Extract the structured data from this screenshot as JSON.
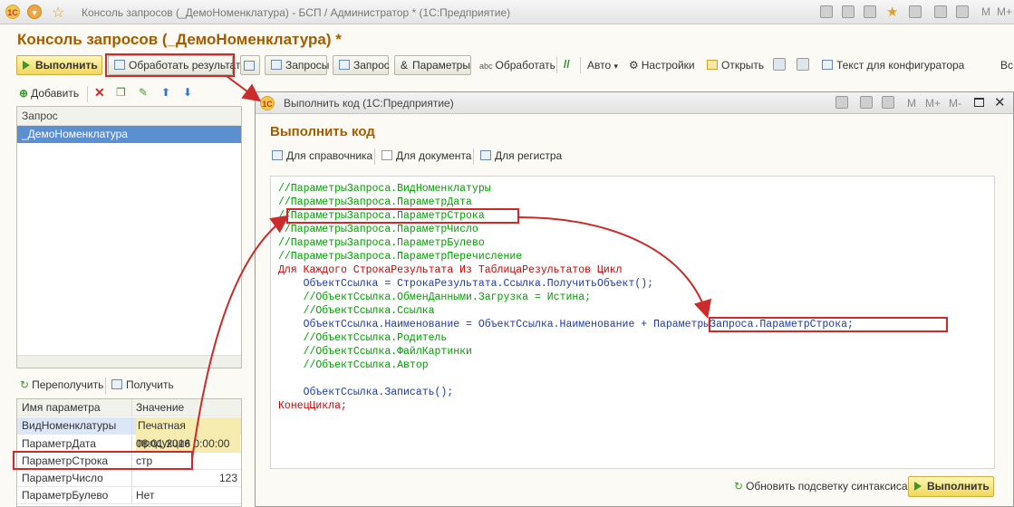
{
  "window": {
    "title": "Консоль запросов (_ДемоНоменклатура) - БСП / Администратор * (1С:Предприятие)",
    "m_labels": [
      "M",
      "M+",
      "M-"
    ]
  },
  "page": {
    "title": "Консоль запросов (_ДемоНоменклатура) *"
  },
  "toolbar": {
    "run": "Выполнить",
    "process": "Обработать результат",
    "queries": "Запросы",
    "query": "Запрос",
    "params": "Параметры",
    "process2": "Обработать",
    "auto": "Авто",
    "settings": "Настройки",
    "open": "Открыть",
    "config_text": "Текст для конфигуратора",
    "more": "Вс"
  },
  "left": {
    "add": "Добавить",
    "list_header": "Запрос",
    "list_item": "_ДемоНоменклатура",
    "refetch": "Переполучить",
    "get": "Получить",
    "param_headers": [
      "Имя параметра",
      "Значение"
    ],
    "params": [
      [
        "ВидНоменклатуры",
        "Печатная продукция"
      ],
      [
        "ПараметрДата",
        "08.01.2016 0:00:00"
      ],
      [
        "ПараметрСтрока",
        "стр"
      ],
      [
        "ПараметрЧисло",
        "123"
      ],
      [
        "ПараметрБулево",
        "Нет"
      ]
    ]
  },
  "dialog": {
    "bar_title": "Выполнить код (1С:Предприятие)",
    "title": "Выполнить код",
    "btn_catalog": "Для справочника",
    "btn_document": "Для документа",
    "btn_register": "Для регистра",
    "code": [
      "//ПараметрыЗапроса.ВидНоменклатуры",
      "//ПараметрыЗапроса.ПараметрДата",
      "//ПараметрыЗапроса.ПараметрСтрока",
      "//ПараметрыЗапроса.ПараметрЧисло",
      "//ПараметрыЗапроса.ПараметрБулево",
      "//ПараметрыЗапроса.ПараметрПеречисление",
      "Для Каждого СтрокаРезультата Из ТаблицаРезультатов Цикл",
      "    ОбъектСсылка = СтрокаРезультата.Ссылка.ПолучитьОбъект();",
      "    //ОбъектСсылка.ОбменДанными.Загрузка = Истина;",
      "    //ОбъектСсылка.Ссылка",
      "    ОбъектСсылка.Наименование = ОбъектСсылка.Наименование + ПараметрыЗапроса.ПараметрСтрока;",
      "    //ОбъектСсылка.Родитель",
      "    //ОбъектСсылка.ФайлКартинки",
      "    //ОбъектСсылка.Автор",
      "",
      "    ОбъектСсылка.Записать();",
      "КонецЦикла;"
    ],
    "refresh": "Обновить подсветку синтаксиса",
    "run": "Выполнить"
  },
  "colors": {
    "accent": "#a35d00",
    "highlight": "#cc2b2b",
    "selection": "#5a8fd0",
    "keyword": "#d00000",
    "comment": "#00a000"
  }
}
